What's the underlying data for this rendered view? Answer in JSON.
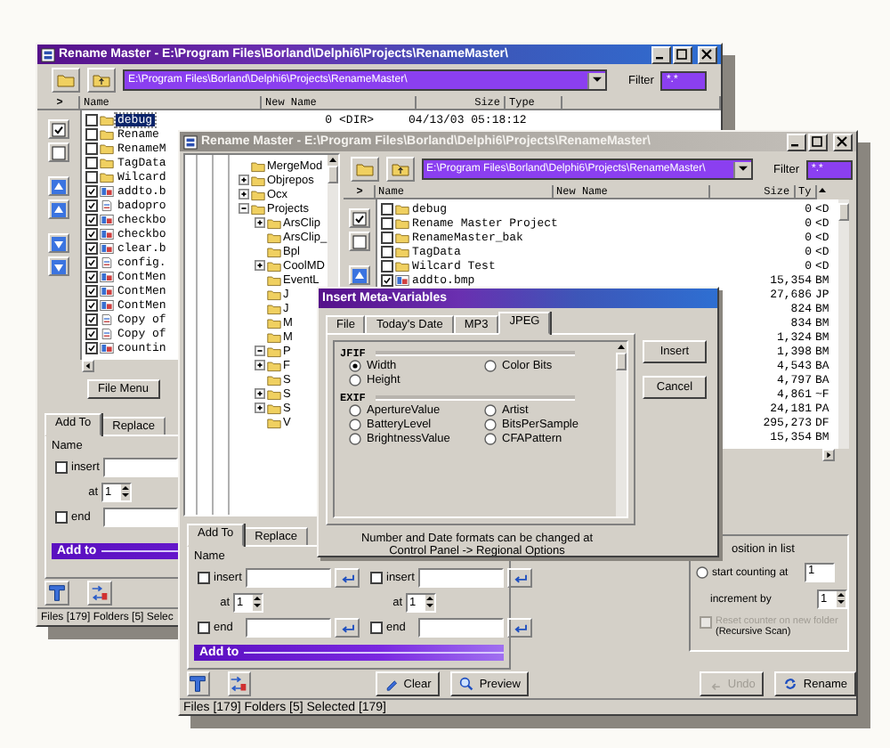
{
  "back_window": {
    "title": "Rename Master - E:\\Program Files\\Borland\\Delphi6\\Projects\\RenameMaster\\",
    "path": "E:\\Program Files\\Borland\\Delphi6\\Projects\\RenameMaster\\",
    "filter_label": "Filter",
    "filter": "*.*",
    "columns": [
      ">",
      "Name",
      "New Name",
      "Size",
      "Type"
    ],
    "rows": [
      {
        "name": "debug",
        "size": "0",
        "type": "<DIR>",
        "date": "04/13/03 05:18:12",
        "kind": "folder",
        "checked": false,
        "selected": true
      },
      {
        "name": "Rename",
        "kind": "folder",
        "checked": false,
        "selected": false
      },
      {
        "name": "RenameM",
        "kind": "folder",
        "checked": false,
        "selected": false
      },
      {
        "name": "TagData",
        "kind": "folder",
        "checked": false,
        "selected": false
      },
      {
        "name": "Wilcard",
        "kind": "folder",
        "checked": false,
        "selected": false
      },
      {
        "name": "addto.b",
        "kind": "image",
        "checked": true,
        "selected": false
      },
      {
        "name": "badopro",
        "kind": "file",
        "checked": true,
        "selected": false
      },
      {
        "name": "checkbo",
        "kind": "image",
        "checked": true,
        "selected": false
      },
      {
        "name": "checkbo",
        "kind": "image",
        "checked": true,
        "selected": false
      },
      {
        "name": "clear.b",
        "kind": "image",
        "checked": true,
        "selected": false
      },
      {
        "name": "config.",
        "kind": "file",
        "checked": true,
        "selected": false
      },
      {
        "name": "ContMen",
        "kind": "image",
        "checked": true,
        "selected": false
      },
      {
        "name": "ContMen",
        "kind": "image",
        "checked": true,
        "selected": false
      },
      {
        "name": "ContMen",
        "kind": "image",
        "checked": true,
        "selected": false
      },
      {
        "name": "Copy of",
        "kind": "file",
        "checked": true,
        "selected": false
      },
      {
        "name": "Copy of",
        "kind": "file",
        "checked": true,
        "selected": false
      },
      {
        "name": "countin",
        "kind": "image",
        "checked": true,
        "selected": false
      }
    ],
    "file_menu": "File Menu",
    "tabs": [
      {
        "label": "Add To",
        "selected": true
      },
      {
        "label": "Replace",
        "selected": false
      }
    ],
    "name_label": "Name",
    "insert": {
      "label": "insert",
      "checked": false
    },
    "at": {
      "label": "at",
      "value": "1"
    },
    "end": {
      "label": "end",
      "checked": false
    },
    "bar_title": "Add to",
    "status": "Files [179] Folders [5] Selec"
  },
  "front_window": {
    "title": "Rename Master - E:\\Program Files\\Borland\\Delphi6\\Projects\\RenameMaster\\",
    "path": "E:\\Program Files\\Borland\\Delphi6\\Projects\\RenameMaster\\",
    "filter_label": "Filter",
    "filter": "*.*",
    "tree": [
      {
        "label": "MergeMod"
      },
      {
        "label": "Objrepos",
        "expanded": false
      },
      {
        "label": "Ocx",
        "expanded": false
      },
      {
        "label": "Projects",
        "expanded": true,
        "children": [
          {
            "label": "ArsClip",
            "expanded": false
          },
          {
            "label": "ArsClip_"
          },
          {
            "label": "Bpl"
          },
          {
            "label": "CoolMD",
            "expanded": false
          },
          {
            "label": "EventL"
          },
          {
            "label": "J"
          },
          {
            "label": "J"
          },
          {
            "label": "M"
          },
          {
            "label": "M"
          },
          {
            "label": "P",
            "expanded": true
          },
          {
            "label": "F",
            "expanded": false
          },
          {
            "label": "S"
          },
          {
            "label": "S",
            "expanded": false
          },
          {
            "label": "S",
            "expanded": false
          },
          {
            "label": "V"
          }
        ]
      }
    ],
    "columns": [
      ">",
      "Name",
      "New Name",
      "Size",
      "Ty"
    ],
    "rows": [
      {
        "name": "debug",
        "size": "0",
        "type": "<D",
        "kind": "folder",
        "checked": false
      },
      {
        "name": "Rename Master Project",
        "size": "0",
        "type": "<D",
        "kind": "folder",
        "checked": false
      },
      {
        "name": "RenameMaster_bak",
        "size": "0",
        "type": "<D",
        "kind": "folder",
        "checked": false
      },
      {
        "name": "TagData",
        "size": "0",
        "type": "<D",
        "kind": "folder",
        "checked": false
      },
      {
        "name": "Wilcard Test",
        "size": "0",
        "type": "<D",
        "kind": "folder",
        "checked": false
      },
      {
        "name": "addto.bmp",
        "size": "15,354",
        "type": "BM",
        "kind": "image",
        "checked": true
      },
      {
        "size": "27,686",
        "type": "JP"
      },
      {
        "size": "824",
        "type": "BM"
      },
      {
        "size": "834",
        "type": "BM"
      },
      {
        "size": "1,324",
        "type": "BM"
      },
      {
        "size": "1,398",
        "type": "BM"
      },
      {
        "size": "4,543",
        "type": "BA"
      },
      {
        "size": "4,797",
        "type": "BA"
      },
      {
        "size": "4,861",
        "type": "~F"
      },
      {
        "size": "24,181",
        "type": "PA"
      },
      {
        "size": "295,273",
        "type": "DF"
      },
      {
        "size": "15,354",
        "type": "BM"
      }
    ],
    "tabs": [
      {
        "label": "Add To",
        "selected": true
      },
      {
        "label": "Replace",
        "selected": false
      }
    ],
    "name_label": "Name",
    "add_columns": [
      {
        "insert": {
          "label": "insert",
          "checked": false
        },
        "at": {
          "label": "at",
          "value": "1"
        },
        "end": {
          "label": "end",
          "checked": false
        }
      },
      {
        "insert": {
          "label": "insert",
          "checked": false
        },
        "at": {
          "label": "at",
          "value": "1"
        },
        "end": {
          "label": "end",
          "checked": false
        }
      }
    ],
    "bar_title": "Add to",
    "counter": {
      "position_label": "osition in list",
      "start": {
        "label": "start counting at",
        "value": "1",
        "selected": false
      },
      "increment": {
        "label": "increment by",
        "value": "1"
      },
      "reset": {
        "label": "Reset counter on new folder",
        "note": "(Recursive Scan)",
        "checked": false,
        "disabled": true
      }
    },
    "actions": [
      {
        "label": "Clear",
        "kind": "clear",
        "disabled": false
      },
      {
        "label": "Preview",
        "kind": "preview",
        "disabled": false
      }
    ],
    "rename_actions": [
      {
        "label": "Undo",
        "kind": "undo",
        "disabled": true
      },
      {
        "label": "Rename",
        "kind": "rename",
        "disabled": false
      }
    ],
    "status": "Files [179] Folders [5] Selected [179]"
  },
  "dialog": {
    "title": "Insert Meta-Variables",
    "tabs": [
      {
        "label": "File",
        "selected": false
      },
      {
        "label": "Today's Date",
        "selected": false
      },
      {
        "label": "MP3",
        "selected": false
      },
      {
        "label": "JPEG",
        "selected": true
      }
    ],
    "sections": [
      {
        "heading": "JFIF",
        "options": [
          {
            "label": "Width",
            "selected": true
          },
          {
            "label": "Color Bits",
            "selected": false
          },
          {
            "label": "Height",
            "selected": false
          }
        ]
      },
      {
        "heading": "EXIF",
        "options": [
          {
            "label": "ApertureValue",
            "selected": false
          },
          {
            "label": "Artist",
            "selected": false
          },
          {
            "label": "BatteryLevel",
            "selected": false
          },
          {
            "label": "BitsPerSample",
            "selected": false
          },
          {
            "label": "BrightnessValue",
            "selected": false
          },
          {
            "label": "CFAPattern",
            "selected": false
          }
        ]
      }
    ],
    "buttons": [
      "Insert",
      "Cancel"
    ],
    "note": "Number and Date formats can be changed at Control Panel -> Regional Options"
  }
}
